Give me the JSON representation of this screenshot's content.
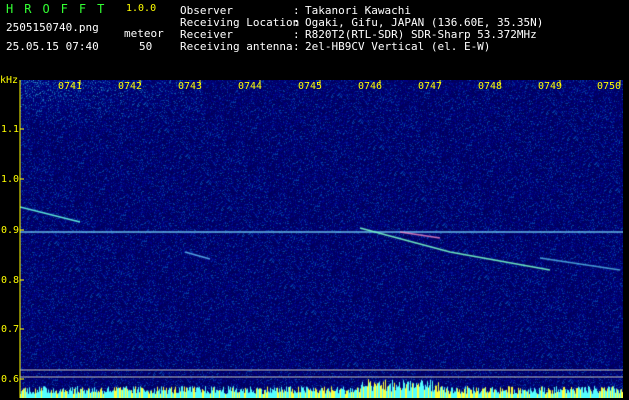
{
  "header": {
    "app_name": "HROFFT",
    "version": "1.0.0",
    "filename": "2505150740.png",
    "datetime": "25.05.15 07:40",
    "meteor_label": "meteor",
    "meteor_count": "50"
  },
  "info": [
    {
      "key": "Observer",
      "value": "Takanori Kawachi"
    },
    {
      "key": "Receiving Location",
      "value": "Ogaki, Gifu, JAPAN (136.60E, 35.35N)"
    },
    {
      "key": "Receiver",
      "value": "R820T2(RTL-SDR) SDR-Sharp 53.372MHz"
    },
    {
      "key": "Receiving antenna",
      "value": "2el-HB9CV Vertical (el. E-W)"
    }
  ],
  "info_separator": ":",
  "axis": {
    "unit_label": "kHz",
    "y_ticks": [
      "1.1",
      "1.0",
      "0.9",
      "0.8",
      "0.7",
      "0.6"
    ],
    "x_ticks": [
      "0741",
      "0742",
      "0743",
      "0744",
      "0745",
      "0746",
      "0747",
      "0748",
      "0749",
      "0750"
    ]
  },
  "colors": {
    "header_green": "#33ff33",
    "header_yellow": "#ffff00",
    "axis_yellow": "#ffff00",
    "background": "#000000",
    "spectrogram_base": "#000a6e",
    "signal_cyan": "#66ffee",
    "signal_yellow": "#ffff40"
  }
}
